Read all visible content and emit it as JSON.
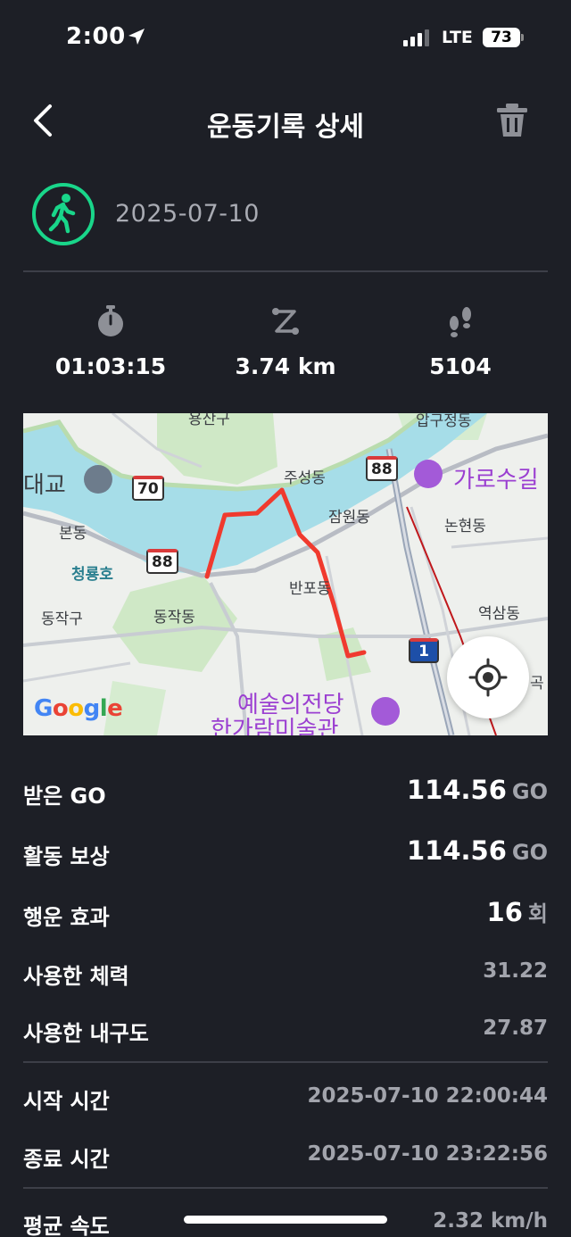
{
  "status_bar": {
    "time": "2:00",
    "network": "LTE",
    "battery": "73"
  },
  "header": {
    "title": "운동기록 상세"
  },
  "activity": {
    "date": "2025-07-10",
    "icon": "walking-person-icon"
  },
  "stats": {
    "duration": "01:03:15",
    "distance": "3.74 km",
    "steps": "5104"
  },
  "map": {
    "labels": [
      "대교",
      "본동",
      "청룡호",
      "동작구",
      "동작동",
      "주성동",
      "잠원동",
      "반포동",
      "논현동",
      "역삼동",
      "가로수길",
      "예술의전당",
      "한가람미술관",
      "곡"
    ],
    "route_shields": [
      "70",
      "88",
      "88",
      "88",
      "1"
    ],
    "attribution": "Google",
    "route_color": "#f03a2e"
  },
  "details": {
    "received_go": {
      "label": "받은 GO",
      "value": "114.56",
      "unit": "GO"
    },
    "activity_reward": {
      "label": "활동 보상",
      "value": "114.56",
      "unit": "GO"
    },
    "luck_effect": {
      "label": "행운 효과",
      "value": "16",
      "unit": "회"
    },
    "used_stamina": {
      "label": "사용한 체력",
      "value": "31.22"
    },
    "used_durability": {
      "label": "사용한 내구도",
      "value": "27.87"
    },
    "start_time": {
      "label": "시작 시간",
      "value": "2025-07-10 22:00:44"
    },
    "end_time": {
      "label": "종료 시간",
      "value": "2025-07-10 23:22:56"
    },
    "avg_speed": {
      "label": "평균 속도",
      "value": "2.32 km/h"
    }
  },
  "colors": {
    "background": "#1d1f26",
    "accent_green": "#19d68a",
    "muted_text": "#a2a4ac"
  }
}
